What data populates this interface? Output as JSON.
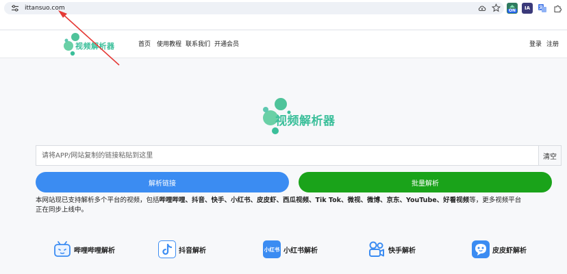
{
  "browser": {
    "url": "ittansuo.com",
    "extensions": [
      {
        "name": "on-extension-icon",
        "text": "ON"
      },
      {
        "name": "ia-extension-icon",
        "text": "IA"
      },
      {
        "name": "translate-extension-icon",
        "text": ""
      },
      {
        "name": "puzzle-extension-icon",
        "text": ""
      }
    ]
  },
  "nav": {
    "logo_text": "视频解析器",
    "links": [
      "首页",
      "使用教程",
      "联系我们",
      "开通会员"
    ],
    "login": "登录",
    "register": "注册"
  },
  "hero": {
    "logo_text": "视频解析器"
  },
  "search": {
    "placeholder": "请将APP/网站复制的链接粘贴到这里",
    "clear_label": "清空"
  },
  "buttons": {
    "parse": "解析链接",
    "batch": "批量解析"
  },
  "description": {
    "prefix": "本网站现已支持解析多个平台的视频，包括",
    "platforms": "哔哩哔哩、抖音、快手、小红书、皮皮虾、西瓜视频、Tik Tok、微视、微博、京东、YouTube、好看视频",
    "suffix": "等，更多视频平台",
    "line2": "正在同步上线中。"
  },
  "platforms": [
    {
      "label": "哔哩哔哩解析",
      "icon": "bilibili-icon",
      "color": "#3b8cf2"
    },
    {
      "label": "抖音解析",
      "icon": "douyin-icon",
      "color": "#3b8cf2"
    },
    {
      "label": "小红书解析",
      "icon": "xiaohongshu-icon",
      "icon_text": "小红书",
      "color": "#3b8cf2"
    },
    {
      "label": "快手解析",
      "icon": "kuaishou-icon",
      "color": "#3b8cf2"
    },
    {
      "label": "皮皮虾解析",
      "icon": "pipixia-icon",
      "color": "#3b8cf2"
    }
  ],
  "colors": {
    "brand_green": "#3bbf9a",
    "primary_blue": "#3b8cf2",
    "success_green": "#1aa31a",
    "annotation_red": "#e53935"
  }
}
